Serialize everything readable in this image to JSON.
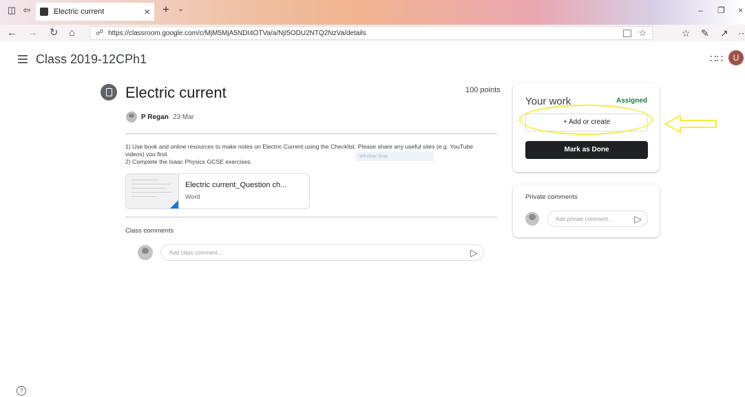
{
  "browser": {
    "tab_title": "Electric current",
    "url": "https://classroom.google.com/c/MjM5MjA5NDI4OTVa/a/NjI5ODU2NTQ2NzVa/details"
  },
  "header": {
    "class_name": "Class 2019-12CPh1",
    "avatar_letter": "U"
  },
  "assignment": {
    "title": "Electric current",
    "points": "100 points",
    "author": "P Regan",
    "date": "23 Mar",
    "instructions_line1": "1) Use book and online resources to make notes on Electric Current using the Checklist. Please share any useful sites (e.g. YouTube videos) you find.",
    "instructions_line2": "2) Complete the Isaac Physics GCSE exercises.",
    "snip_overlay": "Window Snip",
    "attachment": {
      "title": "Electric current_Question ch...",
      "type": "Word"
    },
    "class_comments_label": "Class comments",
    "class_comment_placeholder": "Add class comment..."
  },
  "your_work": {
    "title": "Your work",
    "status": "Assigned",
    "add_label": "+ Add or create",
    "mark_done_label": "Mark as Done"
  },
  "private_comments": {
    "title": "Private comments",
    "placeholder": "Add private comment..."
  },
  "colors": {
    "status_green": "#188038",
    "annotation_yellow": "#f5ee3c",
    "avatar_bg": "#a0524a"
  }
}
